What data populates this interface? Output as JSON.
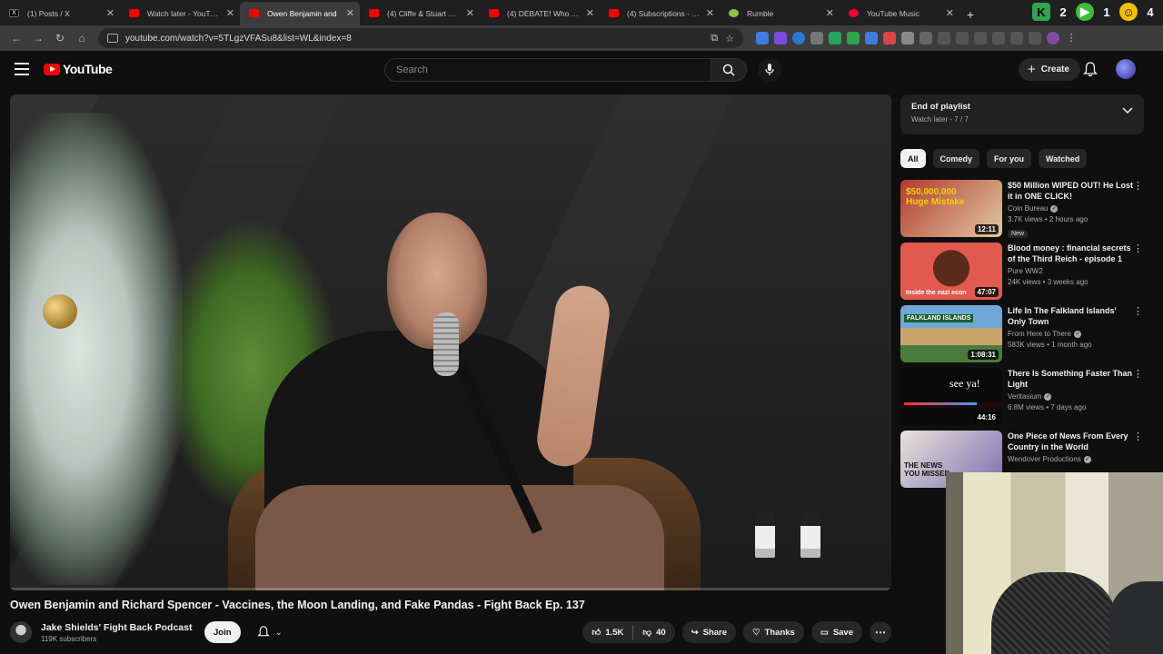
{
  "browser": {
    "tabs": [
      {
        "label": "(1) Posts / X",
        "icon": "x-icon",
        "active": false
      },
      {
        "label": "Watch later - YouTube",
        "icon": "youtube-icon",
        "active": false
      },
      {
        "label": "Owen Benjamin and",
        "icon": "youtube-icon",
        "active": true
      },
      {
        "label": "(4) Cliffe & Stuart Knech",
        "icon": "youtube-icon",
        "active": false
      },
      {
        "label": "(4) DEBATE! Who Are th",
        "icon": "youtube-icon",
        "active": false
      },
      {
        "label": "(4) Subscriptions - YouT",
        "icon": "youtube-icon",
        "active": false
      },
      {
        "label": "Rumble",
        "icon": "rumble-icon",
        "active": false
      },
      {
        "label": "YouTube Music",
        "icon": "youtube-music-icon",
        "active": false
      }
    ],
    "url": "youtube.com/watch?v=5TLgzVFASu8&list=WL&index=8",
    "top_right_numbers": [
      "2",
      "1",
      "4"
    ]
  },
  "header": {
    "logo_text": "YouTube",
    "search_placeholder": "Search",
    "create_label": "Create"
  },
  "video": {
    "title": "Owen Benjamin and Richard Spencer - Vaccines, the Moon Landing, and Fake Pandas - Fight Back Ep. 137",
    "channel": "Jake Shields' Fight Back Podcast",
    "subscribers": "119K subscribers",
    "join_label": "Join",
    "likes": "1.5K",
    "dislikes": "40",
    "share_label": "Share",
    "thanks_label": "Thanks",
    "save_label": "Save"
  },
  "playlist": {
    "title": "End of playlist",
    "subtitle": "Watch later - 7 / 7"
  },
  "chips": [
    "All",
    "Comedy",
    "For you",
    "Watched"
  ],
  "recommendations": [
    {
      "title": "$50 Million WIPED OUT! He Lost it in ONE CLICK!",
      "channel": "Coin Bureau",
      "verified": true,
      "meta": "3.7K views • 2 hours ago",
      "duration": "12:11",
      "badge": "New",
      "thumb_text": "$50,000,000 Huge Mistake",
      "thumb_color": "#b23b2e"
    },
    {
      "title": "Blood money : financial secrets of the Third Reich - episode 1 :...",
      "channel": "Pure WW2",
      "verified": false,
      "meta": "24K views • 3 weeks ago",
      "duration": "47:07",
      "badge": "",
      "thumb_text": "Inside the nazi econ",
      "thumb_color": "#c44a43"
    },
    {
      "title": "Life In The Falkland Islands' Only Town",
      "channel": "From Here to There",
      "verified": true,
      "meta": "583K views • 1 month ago",
      "duration": "1:08:31",
      "badge": "",
      "thumb_text": "FALKLAND ISLANDS",
      "thumb_color": "#3a7fb8"
    },
    {
      "title": "There Is Something Faster Than Light",
      "channel": "Veritasium",
      "verified": true,
      "meta": "6.8M views • 7 days ago",
      "duration": "44:16",
      "badge": "",
      "thumb_text": "see ya!",
      "thumb_color": "#111111"
    },
    {
      "title": "One Piece of News From Every Country in the World",
      "channel": "Wendover Productions",
      "verified": true,
      "meta": "",
      "duration": "",
      "badge": "",
      "thumb_text": "THE NEWS YOU MISSED",
      "thumb_color": "#5b4f8a"
    }
  ]
}
